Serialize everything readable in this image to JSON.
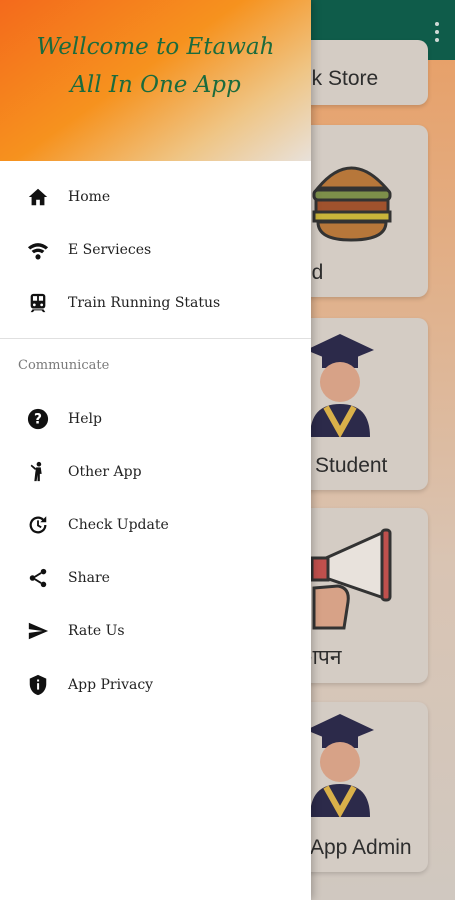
{
  "drawer": {
    "title_line1": "Wellcome to Etawah",
    "title_line2": "All In One App",
    "section_label": "Communicate",
    "items_main": [
      {
        "label": "Home",
        "icon": "home-icon"
      },
      {
        "label": "E Servieces",
        "icon": "wifi-icon"
      },
      {
        "label": "Train Running Status",
        "icon": "train-icon"
      }
    ],
    "items_communicate": [
      {
        "label": "Help",
        "icon": "help-icon"
      },
      {
        "label": "Other App",
        "icon": "person-icon"
      },
      {
        "label": "Check Update",
        "icon": "update-icon"
      },
      {
        "label": "Share",
        "icon": "share-icon"
      },
      {
        "label": "Rate Us",
        "icon": "send-icon"
      },
      {
        "label": "App Privacy",
        "icon": "shield-icon"
      }
    ]
  },
  "background": {
    "cards": [
      {
        "label": "ok Store"
      },
      {
        "label": "od"
      },
      {
        "label": "Student"
      },
      {
        "label": "ापन"
      },
      {
        "label": "App Admin"
      }
    ]
  },
  "colors": {
    "appbar": "#0f5c4a",
    "header_gradient_start": "#f46a1c",
    "title_text": "#1b6b3d"
  }
}
